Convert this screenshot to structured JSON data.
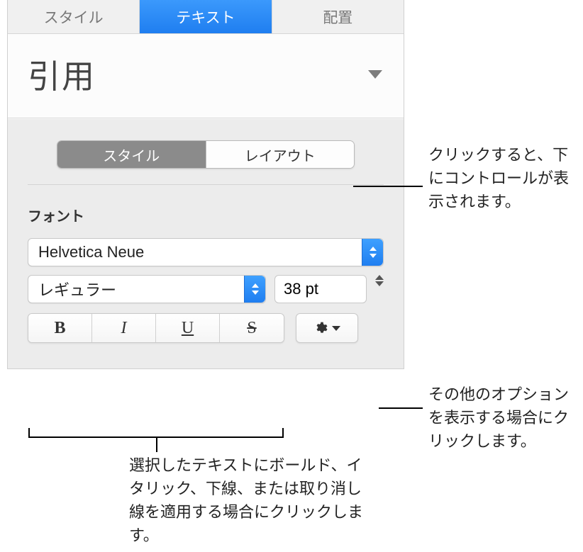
{
  "tabs": {
    "style": "スタイル",
    "text": "テキスト",
    "arrange": "配置"
  },
  "paragraphStyle": {
    "name": "引用"
  },
  "segmented": {
    "style": "スタイル",
    "layout": "レイアウト"
  },
  "font": {
    "sectionLabel": "フォント",
    "family": "Helvetica Neue",
    "variant": "レギュラー",
    "size": "38 pt",
    "bold": "B",
    "italic": "I",
    "underline": "U",
    "strike": "S"
  },
  "callouts": {
    "layoutTab": "クリックすると、下にコントロールが表示されます。",
    "advanced": "その他のオプションを表示する場合にクリックします。",
    "styleButtons": "選択したテキストにボールド、イタリック、下線、または取り消し線を適用する場合にクリックします。"
  }
}
